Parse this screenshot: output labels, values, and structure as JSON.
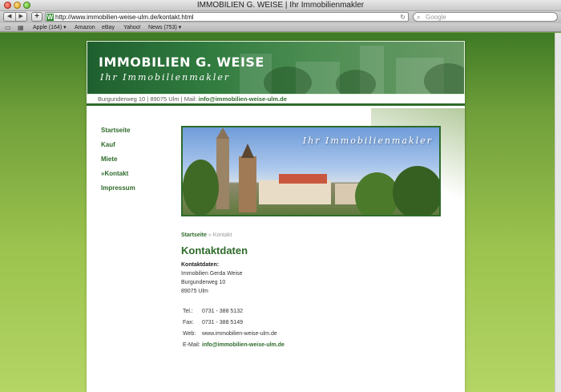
{
  "browser": {
    "window_title": "IMMOBILIEN G. WEISE | Ihr Immobilienmakler",
    "back_glyph": "◀",
    "forward_glyph": "▶",
    "add_glyph": "+",
    "favicon_letter": "W",
    "url": "http://www.immobilien-weise-ulm.de/kontakt.html",
    "reload_glyph": "↻",
    "search_placeholder": "Google",
    "bookmarks": [
      "Apple (164) ▾",
      "Amazon",
      "eBay",
      "Yahoo!",
      "News (753) ▾"
    ]
  },
  "site": {
    "title": "IMMOBILIEN G. WEISE",
    "tagline": "Ihr Immobilienmakler",
    "address_line": "Burgunderweg 10 | 89075 Ulm | Mail:",
    "address_email": "info@immobilien-weise-ulm.de",
    "nav": [
      "Startseite",
      "Kauf",
      "Miete",
      "»Kontakt",
      "Impressum"
    ],
    "photo_tagline": "Ihr Immobilienmakler"
  },
  "content": {
    "breadcrumb_link": "Startseite",
    "breadcrumb_current": "» Kontakt",
    "heading": "Kontaktdaten",
    "label": "Kontaktdaten:",
    "address": [
      "Immobilien Gerda Weise",
      "Burgunderweg 10",
      "89075 Ulm"
    ],
    "contact": [
      {
        "key": "Tel.:",
        "value": "0731 - 388 5132"
      },
      {
        "key": "Fax:",
        "value": "0731 - 388 5149"
      },
      {
        "key": "Web:",
        "value": "www.immobilien-weise-ulm.de"
      },
      {
        "key": "E-Mail:",
        "value": "info@immobilien-weise-ulm.de"
      }
    ]
  },
  "colors": {
    "brand_green": "#2e6b2a",
    "page_bg_top": "#3f7a25",
    "page_bg_bottom": "#b4d564"
  }
}
